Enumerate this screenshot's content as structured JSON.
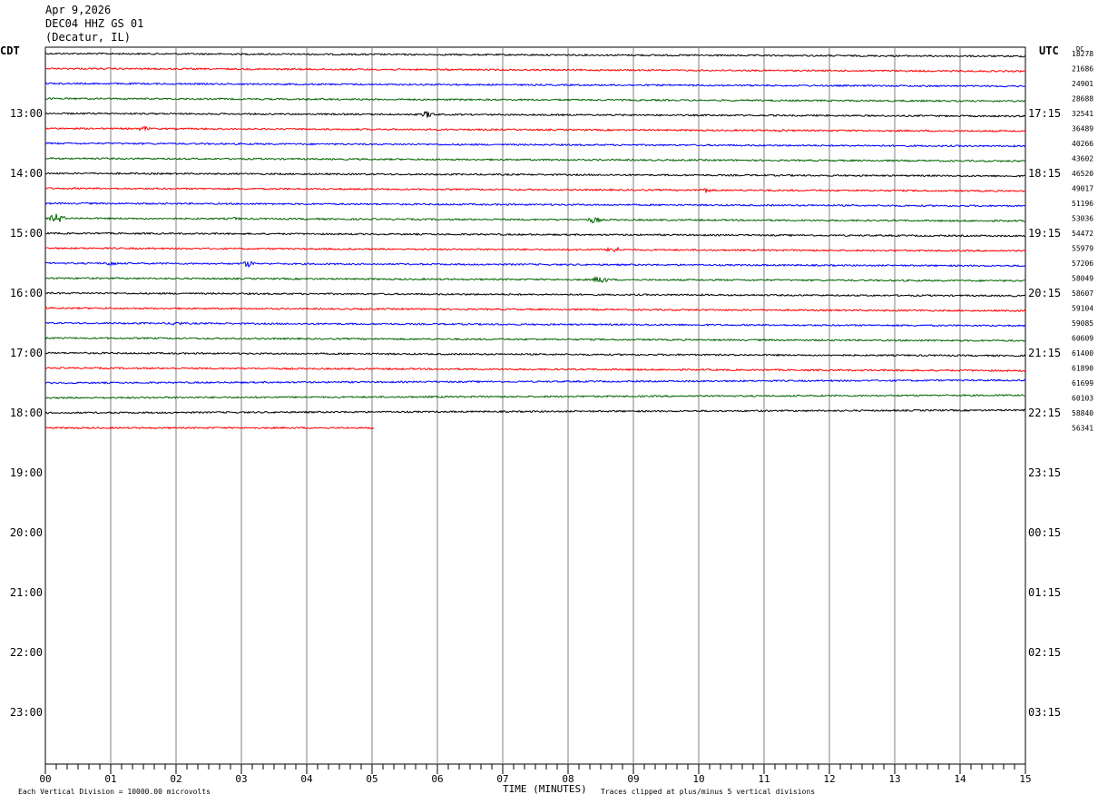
{
  "header": {
    "date": "Apr 9,2026",
    "station": "DEC04 HHZ GS 01",
    "location": "(Decatur, IL)"
  },
  "left_zone_label": "CDT",
  "right_zone_label": "UTC",
  "dc_label": "DC",
  "footer": {
    "scale_note": "Each Vertical Division = 10000.00 microvolts",
    "x_axis_title": "TIME (MINUTES)",
    "clip_note": "Traces clipped at plus/minus 5 vertical divisions"
  },
  "chart_data": {
    "type": "line",
    "title": "",
    "xlabel": "TIME (MINUTES)",
    "ylabel": "",
    "xlim": [
      0,
      15
    ],
    "x_ticks": [
      "00",
      "01",
      "02",
      "03",
      "04",
      "05",
      "06",
      "07",
      "08",
      "09",
      "10",
      "11",
      "12",
      "13",
      "14",
      "15"
    ],
    "grid": true,
    "rows_per_hour": 4,
    "hour_labels_cdt": [
      "13:00",
      "14:00",
      "15:00",
      "16:00",
      "17:00",
      "18:00",
      "19:00",
      "20:00",
      "21:00",
      "22:00",
      "23:00"
    ],
    "hour_labels_utc": [
      "17:15",
      "18:15",
      "19:15",
      "20:15",
      "21:15",
      "22:15",
      "23:15",
      "00:15",
      "01:15",
      "02:15",
      "03:15"
    ],
    "trace_colors": [
      "#000000",
      "#ff0000",
      "#0000ff",
      "#006400"
    ],
    "dc_offsets": [
      "18278",
      "21686",
      "24901",
      "28688",
      "32541",
      "36489",
      "40266",
      "43602",
      "46520",
      "49017",
      "51196",
      "53036",
      "54472",
      "55979",
      "57206",
      "58049",
      "58607",
      "59104",
      "59085",
      "60609",
      "61400",
      "61890",
      "61699",
      "60103",
      "58840",
      "56341"
    ],
    "traces": [
      {
        "row": 0,
        "color": "black",
        "duration_min": 15,
        "drift": 1
      },
      {
        "row": 1,
        "color": "red",
        "duration_min": 15,
        "drift": 1
      },
      {
        "row": 2,
        "color": "blue",
        "duration_min": 15,
        "drift": 1
      },
      {
        "row": 3,
        "color": "green",
        "duration_min": 15,
        "drift": 1
      },
      {
        "row": 4,
        "color": "black",
        "duration_min": 15,
        "drift": 1
      },
      {
        "row": 5,
        "color": "red",
        "duration_min": 15,
        "drift": 1
      },
      {
        "row": 6,
        "color": "blue",
        "duration_min": 15,
        "drift": 1
      },
      {
        "row": 7,
        "color": "green",
        "duration_min": 15,
        "drift": 1
      },
      {
        "row": 8,
        "color": "black",
        "duration_min": 15,
        "drift": 1
      },
      {
        "row": 9,
        "color": "red",
        "duration_min": 15,
        "drift": 1
      },
      {
        "row": 10,
        "color": "blue",
        "duration_min": 15,
        "drift": 1
      },
      {
        "row": 11,
        "color": "green",
        "duration_min": 15,
        "drift": 1
      },
      {
        "row": 12,
        "color": "black",
        "duration_min": 15,
        "drift": 1
      },
      {
        "row": 13,
        "color": "red",
        "duration_min": 15,
        "drift": 1
      },
      {
        "row": 14,
        "color": "blue",
        "duration_min": 15,
        "drift": 1
      },
      {
        "row": 15,
        "color": "green",
        "duration_min": 15,
        "drift": 1
      },
      {
        "row": 16,
        "color": "black",
        "duration_min": 15,
        "drift": 1
      },
      {
        "row": 17,
        "color": "red",
        "duration_min": 15,
        "drift": 1
      },
      {
        "row": 18,
        "color": "blue",
        "duration_min": 15,
        "drift": 1
      },
      {
        "row": 19,
        "color": "green",
        "duration_min": 15,
        "drift": 1
      },
      {
        "row": 20,
        "color": "black",
        "duration_min": 15,
        "drift": 1
      },
      {
        "row": 21,
        "color": "red",
        "duration_min": 15,
        "drift": 1
      },
      {
        "row": 22,
        "color": "blue",
        "duration_min": 15,
        "drift": -1
      },
      {
        "row": 23,
        "color": "green",
        "duration_min": 15,
        "drift": -1
      },
      {
        "row": 24,
        "color": "black",
        "duration_min": 15,
        "drift": -1
      },
      {
        "row": 25,
        "color": "red",
        "duration_min": 5.03,
        "drift": 0
      }
    ],
    "events": [
      {
        "row": 4,
        "minute": 5.85,
        "amplitude": 4
      },
      {
        "row": 5,
        "minute": 1.5,
        "amplitude": 3
      },
      {
        "row": 5,
        "minute": 11.3,
        "amplitude": 2
      },
      {
        "row": 9,
        "minute": 10.1,
        "amplitude": 3
      },
      {
        "row": 11,
        "minute": 0.18,
        "amplitude": 6
      },
      {
        "row": 11,
        "minute": 2.9,
        "amplitude": 2
      },
      {
        "row": 11,
        "minute": 8.4,
        "amplitude": 4
      },
      {
        "row": 13,
        "minute": 8.7,
        "amplitude": 4
      },
      {
        "row": 14,
        "minute": 1.0,
        "amplitude": 3
      },
      {
        "row": 14,
        "minute": 3.1,
        "amplitude": 4
      },
      {
        "row": 15,
        "minute": 8.5,
        "amplitude": 5
      },
      {
        "row": 18,
        "minute": 2.0,
        "amplitude": 3
      }
    ]
  }
}
